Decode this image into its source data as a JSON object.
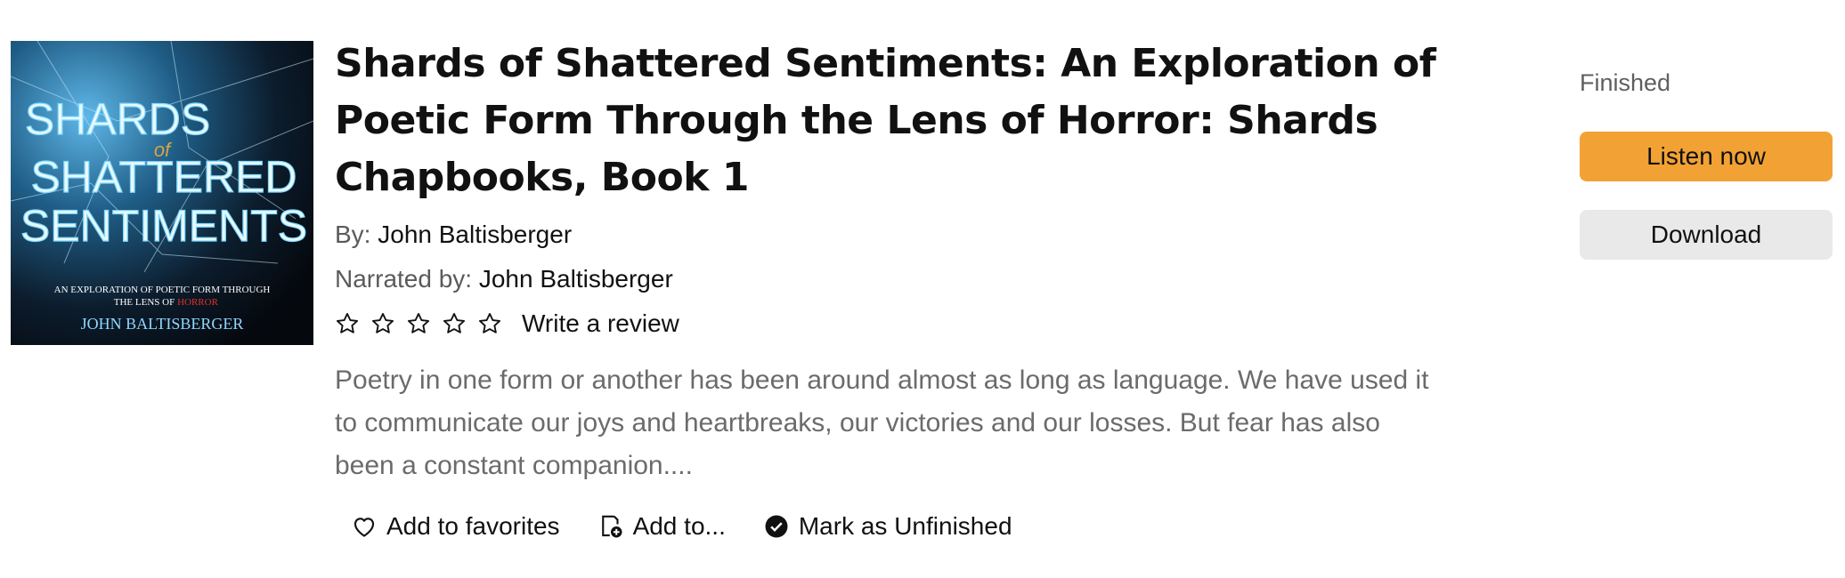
{
  "book": {
    "title": "Shards of Shattered Sentiments: An Exploration of Poetic Form Through the Lens of Horror: Shards Chapbooks, Book 1",
    "author_label": "By:",
    "author": "John Baltisberger",
    "narrator_label": "Narrated by:",
    "narrator": "John Baltisberger",
    "rating_stars": 0,
    "rating_max": 5,
    "write_review": "Write a review",
    "summary": "Poetry in one form or another has been around almost as long as language. We have used it to communicate our joys and heartbreaks, our victories and our losses. But fear has also been a constant companion...."
  },
  "cover": {
    "line1": "SHARDS",
    "line2": "of",
    "line3": "SHATTERED",
    "line4": "SENTIMENTS",
    "subtitle_a": "AN EXPLORATION OF POETIC FORM THROUGH",
    "subtitle_b": "THE LENS OF",
    "subtitle_c": "HORROR",
    "author": "JOHN BALTISBERGER"
  },
  "actions": {
    "favorites": "Add to favorites",
    "add_to": "Add to...",
    "mark": "Mark as Unfinished"
  },
  "side": {
    "status": "Finished",
    "listen": "Listen now",
    "download": "Download"
  },
  "colors": {
    "accent": "#f2a234",
    "secondary_button": "#e9e9e9",
    "muted_text": "#6b6b6b",
    "cover_glow": "#9fe6ff"
  }
}
